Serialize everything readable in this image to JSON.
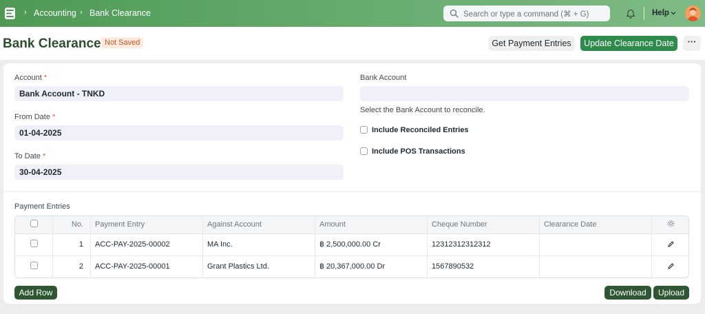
{
  "navbar": {
    "breadcrumbs": [
      "Accounting",
      "Bank Clearance"
    ],
    "search_placeholder": "Search or type a command (⌘ + G)",
    "help_label": "Help",
    "colors": {
      "start": "#4e9a55",
      "end": "#7fbb86"
    }
  },
  "page": {
    "title": "Bank Clearance",
    "status": "Not Saved",
    "get_payment_entries": "Get Payment Entries",
    "update_clearance_date": "Update Clearance Date",
    "more": "···"
  },
  "form": {
    "account_label": "Account",
    "account_value": "Bank Account - TNKD",
    "from_date_label": "From Date",
    "from_date_value": "01-04-2025",
    "to_date_label": "To Date",
    "to_date_value": "30-04-2025",
    "required_mark": "*",
    "bank_account_label": "Bank Account",
    "bank_account_value": "",
    "bank_account_description": "Select the Bank Account to reconcile.",
    "include_reconciled": "Include Reconciled Entries",
    "include_pos": "Include POS Transactions"
  },
  "table": {
    "title": "Payment Entries",
    "columns": [
      "No.",
      "Payment Entry",
      "Against Account",
      "Amount",
      "Cheque Number",
      "Clearance Date"
    ],
    "rows": [
      {
        "no": "1",
        "payment_entry": "ACC-PAY-2025-00002",
        "against_account": "MA Inc.",
        "amount": "฿ 2,500,000.00 Cr",
        "cheque_number": "12312312312312",
        "clearance_date": ""
      },
      {
        "no": "2",
        "payment_entry": "ACC-PAY-2025-00001",
        "against_account": "Grant Plastics Ltd.",
        "amount": "฿ 20,367,000.00 Dr",
        "cheque_number": "1567890532",
        "clearance_date": ""
      }
    ],
    "add_row": "Add Row",
    "download": "Download",
    "upload": "Upload"
  }
}
